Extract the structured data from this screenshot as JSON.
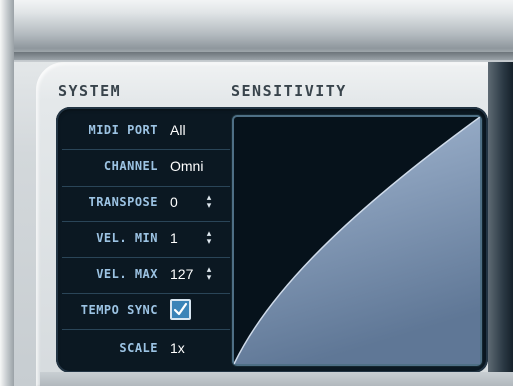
{
  "sections": {
    "system": "SYSTEM",
    "sensitivity": "SENSITIVITY"
  },
  "params": {
    "midi_port": {
      "label": "MIDI PORT",
      "value": "All"
    },
    "channel": {
      "label": "CHANNEL",
      "value": "Omni"
    },
    "transpose": {
      "label": "TRANSPOSE",
      "value": "0"
    },
    "vel_min": {
      "label": "VEL. MIN",
      "value": "1"
    },
    "vel_max": {
      "label": "VEL. MAX",
      "value": "127"
    },
    "tempo_sync": {
      "label": "TEMPO SYNC",
      "checked": true
    },
    "scale": {
      "label": "SCALE",
      "value": "1x"
    }
  },
  "icons": {
    "stepper": "up-down-arrows-icon",
    "checkmark": "checkmark-icon"
  },
  "colors": {
    "label": "#9cc3e3",
    "value": "#ffffff",
    "panel_dark": "#0b1822",
    "curve_fill": "#8fa6c6",
    "checkbox": "#3b84b8"
  }
}
